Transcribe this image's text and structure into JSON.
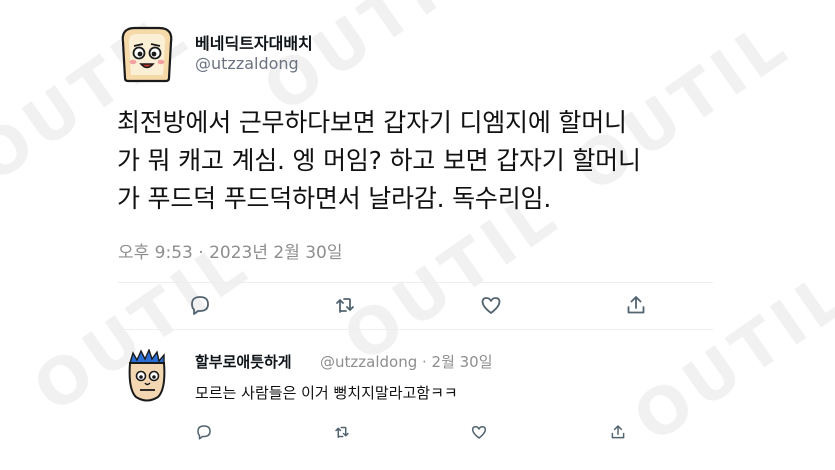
{
  "tweet": {
    "author_name": "베네딕트자대배치",
    "author_handle": "@utzzaldong",
    "text_lines": [
      "최전방에서 근무하다보면 갑자기 디엠지에 할머니",
      "가 뭐 캐고 계심. 엥 머임? 하고 보면 갑자기 할머니",
      "가 푸드덕 푸드덕하면서 날라감. 독수리임."
    ],
    "timestamp": "오후 9:53 · 2023년 2월 30일",
    "actions": [
      "reply-icon",
      "retweet-icon",
      "like-icon",
      "share-icon"
    ]
  },
  "reply": {
    "author_name": "할부로애틋하게",
    "meta": "@utzzaldong · 2월 30일",
    "text": "모르는 사람들은 이거 뻥치지말라고함ㅋㅋ",
    "actions": [
      "reply-icon",
      "retweet-icon",
      "like-icon",
      "share-icon"
    ]
  },
  "colors": {
    "text": "#0f1419",
    "muted": "#8e8e8e",
    "icon": "#536471",
    "divider": "#eeeeee"
  }
}
